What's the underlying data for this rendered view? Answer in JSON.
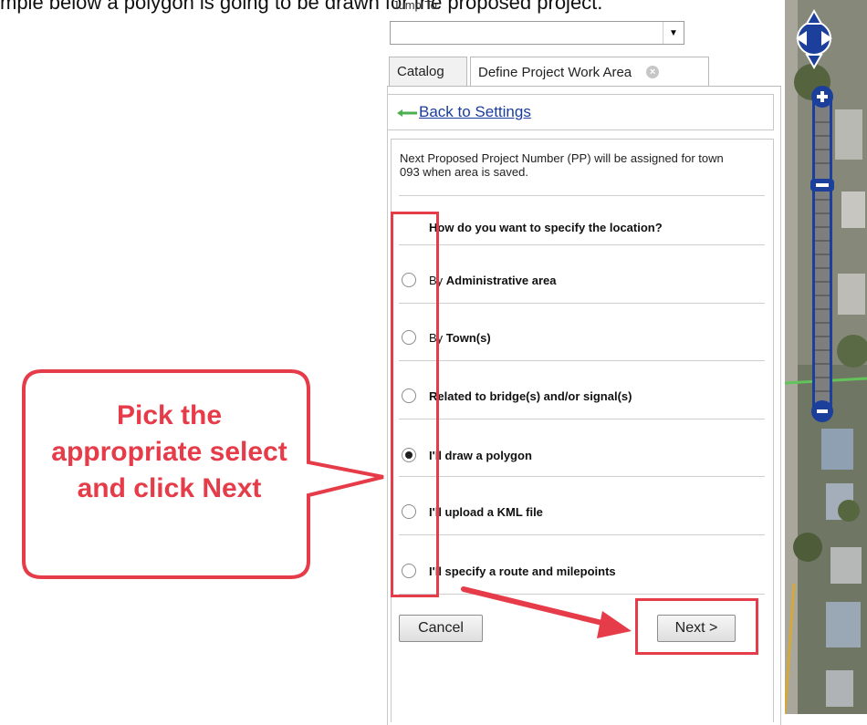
{
  "doc": {
    "top_text": "mple below a polygon is going to be drawn for the proposed project."
  },
  "panel": {
    "jump_label": "Jump To:",
    "jump_value": "",
    "tabs": [
      {
        "label": "Catalog",
        "active": false
      },
      {
        "label": "Define Project Work Area",
        "active": true
      }
    ],
    "back_label": "Back to Settings",
    "info_text": "Next Proposed Project Number (PP) will be assigned for town 093 when area is saved.",
    "question": "How do you want to specify the location?",
    "options": [
      {
        "prefix": "By ",
        "label": "Administrative area",
        "checked": false
      },
      {
        "prefix": "By ",
        "label": "Town(s)",
        "checked": false
      },
      {
        "prefix": "",
        "label": "Related to bridge(s) and/or signal(s)",
        "checked": false
      },
      {
        "prefix": "",
        "label": "I'll draw a polygon",
        "checked": true
      },
      {
        "prefix": "",
        "label": "I'll upload a KML file",
        "checked": false
      },
      {
        "prefix": "",
        "label": "I'll specify a route and milepoints",
        "checked": false
      }
    ],
    "cancel_label": "Cancel",
    "next_label": "Next >"
  },
  "annotation": {
    "callout_text": "Pick the appropriate select and click Next",
    "color": "#e63b48"
  },
  "map": {
    "pan_icon": "pan-control-icon",
    "zoom_in_icon": "zoom-in-icon",
    "zoom_out_icon": "zoom-out-icon",
    "zoom_level_fraction": 0.2
  }
}
